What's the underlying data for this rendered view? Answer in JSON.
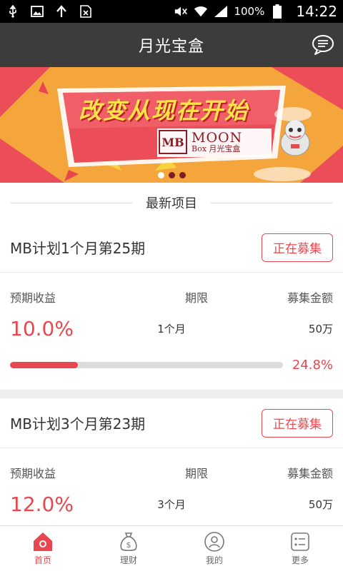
{
  "status_bar": {
    "icons": [
      "usb-icon",
      "image-icon",
      "upload-icon",
      "sim-icon",
      "mute-icon",
      "wifi-icon",
      "signal-icon",
      "battery-icon"
    ],
    "battery": "100%",
    "time": "14:22"
  },
  "header": {
    "title": "月光宝盒",
    "message_icon": "message-icon"
  },
  "banner": {
    "headline": "改变从现在开始",
    "logo_mark": "MB",
    "logo_word": "MOON",
    "logo_sub": "Box 月光宝盒",
    "active_slide": 1,
    "slide_count": 3
  },
  "section": {
    "title": "最新项目"
  },
  "products": [
    {
      "name": "MB计划1个月第25期",
      "status": "正在募集",
      "label_rate": "预期收益",
      "label_period": "期限",
      "label_amount": "募集金额",
      "rate": "10.0%",
      "period": "1个月",
      "amount": "50万",
      "progress": 0.248,
      "progress_text": "24.8%"
    },
    {
      "name": "MB计划3个月第23期",
      "status": "正在募集",
      "label_rate": "预期收益",
      "label_period": "期限",
      "label_amount": "募集金额",
      "rate": "12.0%",
      "period": "3个月",
      "amount": "50万"
    }
  ],
  "tabbar": {
    "items": [
      {
        "label": "首页",
        "icon": "home-icon",
        "active": true
      },
      {
        "label": "理财",
        "icon": "money-bag-icon",
        "active": false
      },
      {
        "label": "我的",
        "icon": "user-icon",
        "active": false
      },
      {
        "label": "更多",
        "icon": "more-list-icon",
        "active": false
      }
    ]
  },
  "colors": {
    "accent": "#e8474f",
    "navbar": "#3c3c3c",
    "banner_red": "#ec4e59",
    "banner_yellow": "#f4a63c"
  }
}
